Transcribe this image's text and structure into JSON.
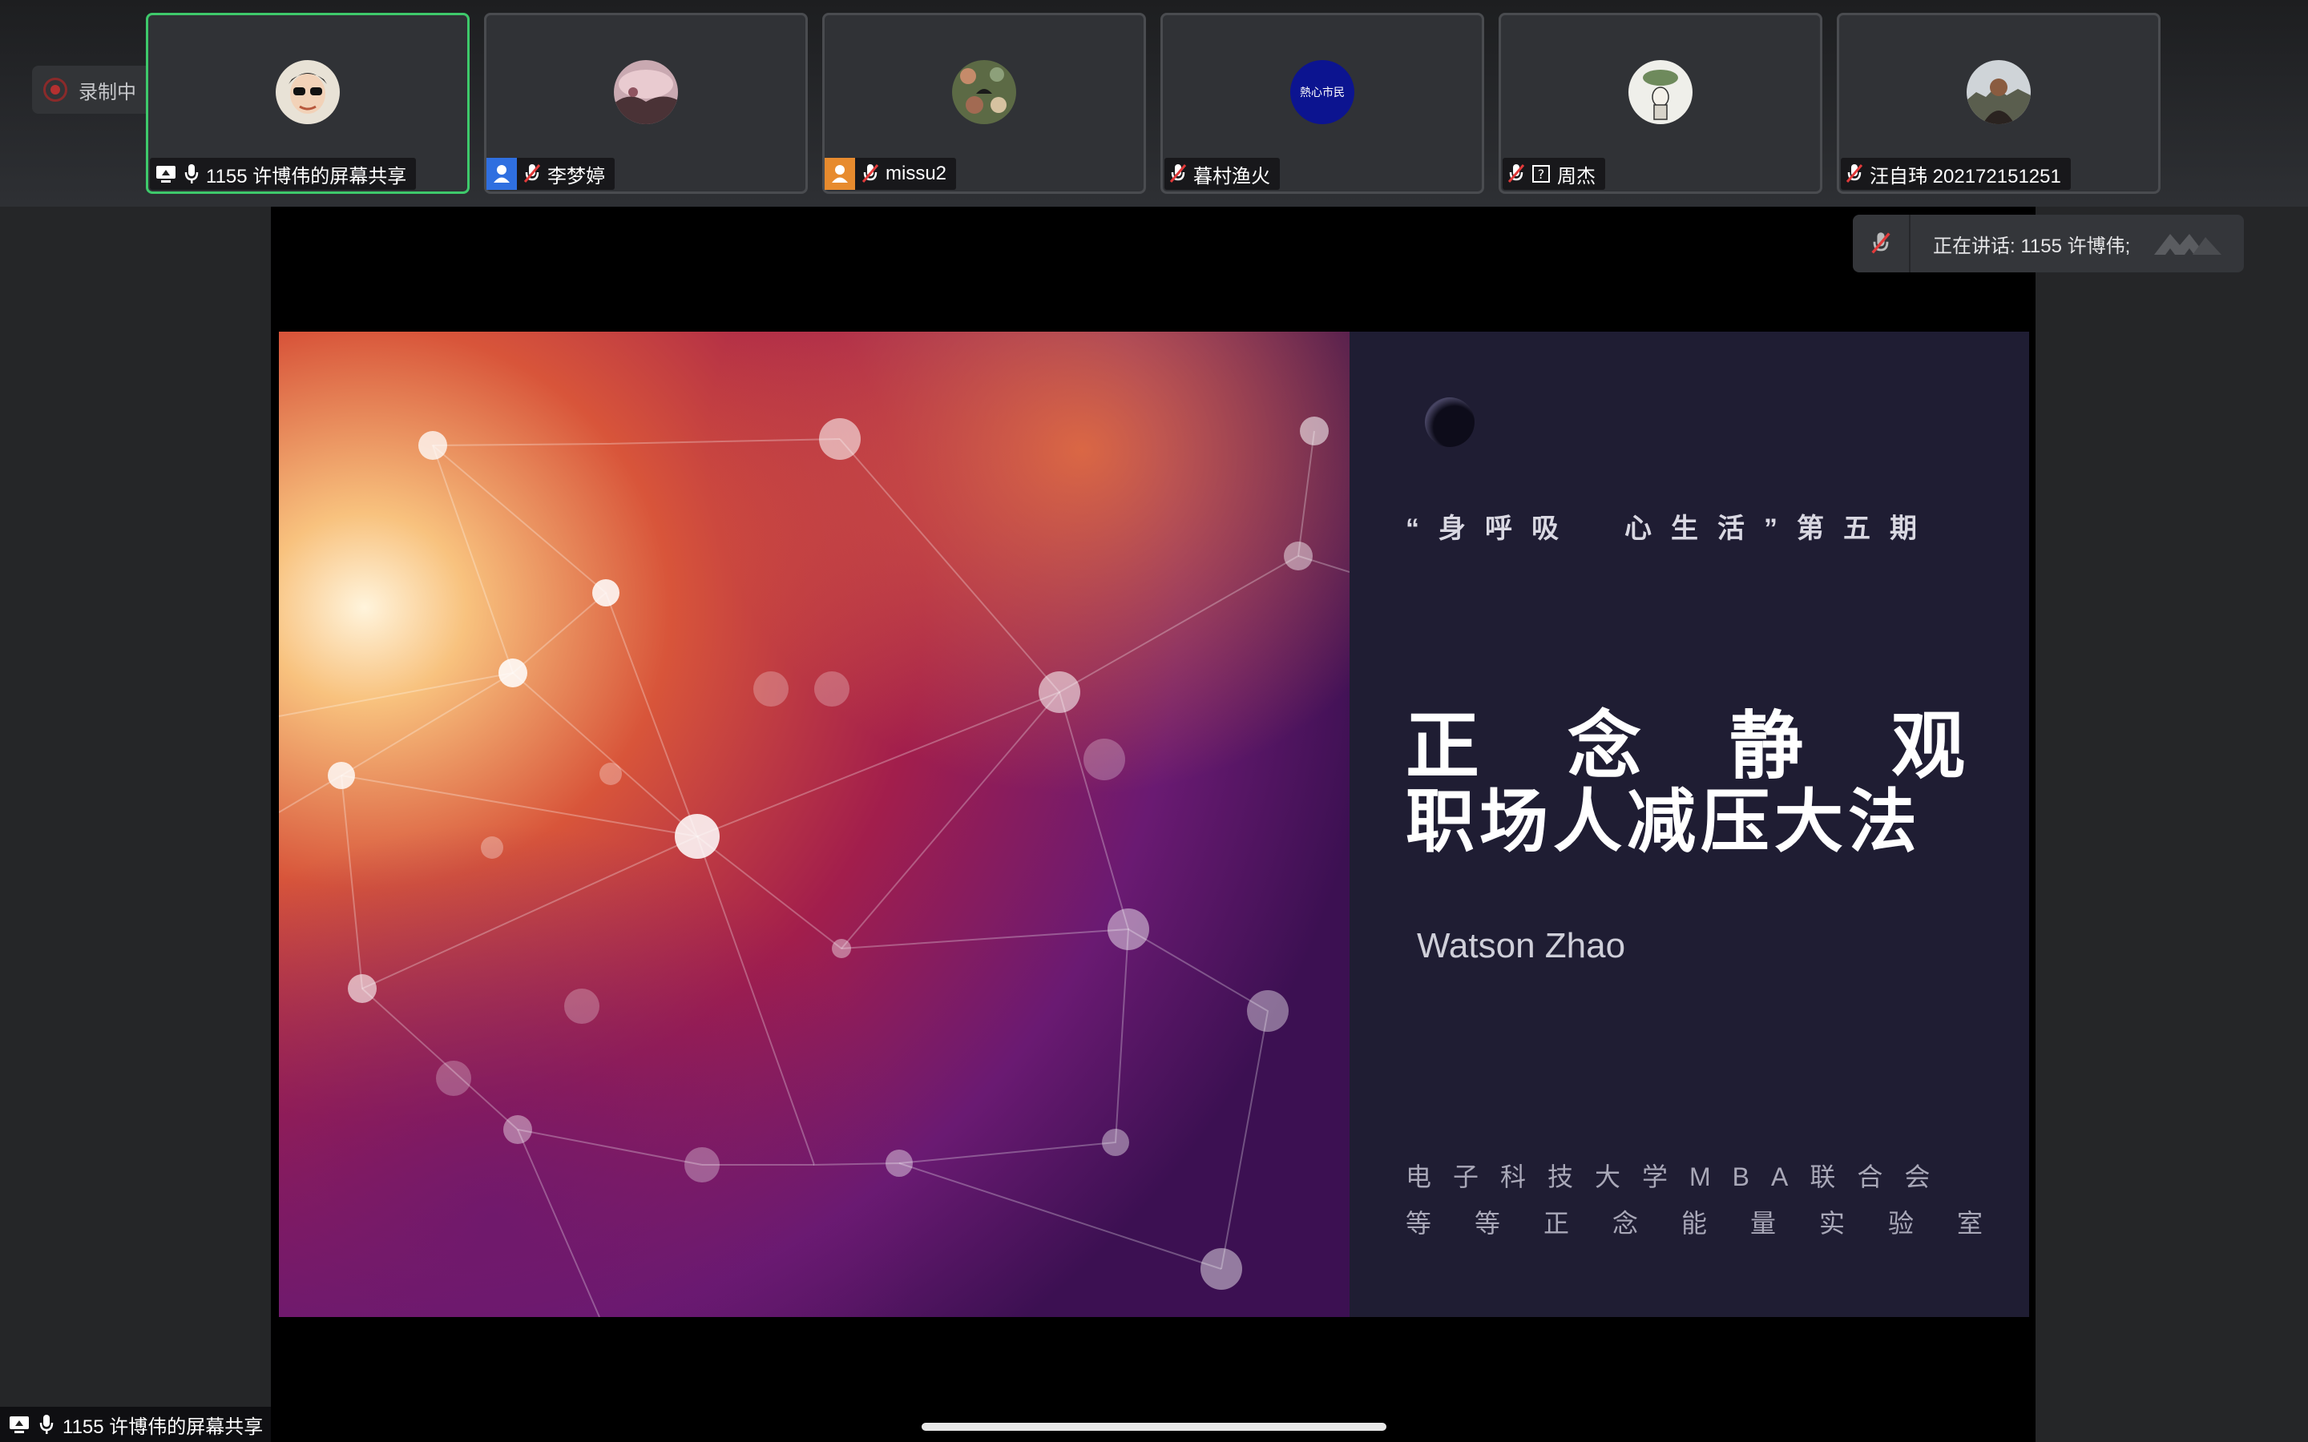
{
  "recording": {
    "label": "录制中"
  },
  "participants": [
    {
      "name": "1155 许博伟的屏幕共享",
      "active": true
    },
    {
      "name": "李梦婷",
      "active": false
    },
    {
      "name": "missu2",
      "active": false
    },
    {
      "name": "暮村渔火",
      "active": false
    },
    {
      "name": "周杰",
      "active": false
    },
    {
      "name": "汪自玮 202172151251",
      "active": false
    }
  ],
  "avatar_texts": {
    "p4": "熱心市民"
  },
  "speaking": {
    "label": "正在讲话: 1155 许博伟;"
  },
  "slide": {
    "series": "“身呼吸　心生活”第五期",
    "title_line1": "正念静观",
    "title_line2": "职场人减压大法",
    "author": "Watson Zhao",
    "org_line1": "电子科技大学MBA联合会",
    "org_line2": "等等正念能量实验室"
  },
  "share_label": "1155 许博伟的屏幕共享",
  "colors": {
    "active_border": "#3ec96b",
    "background": "#252628",
    "slide_panel": "#1f1d33"
  }
}
